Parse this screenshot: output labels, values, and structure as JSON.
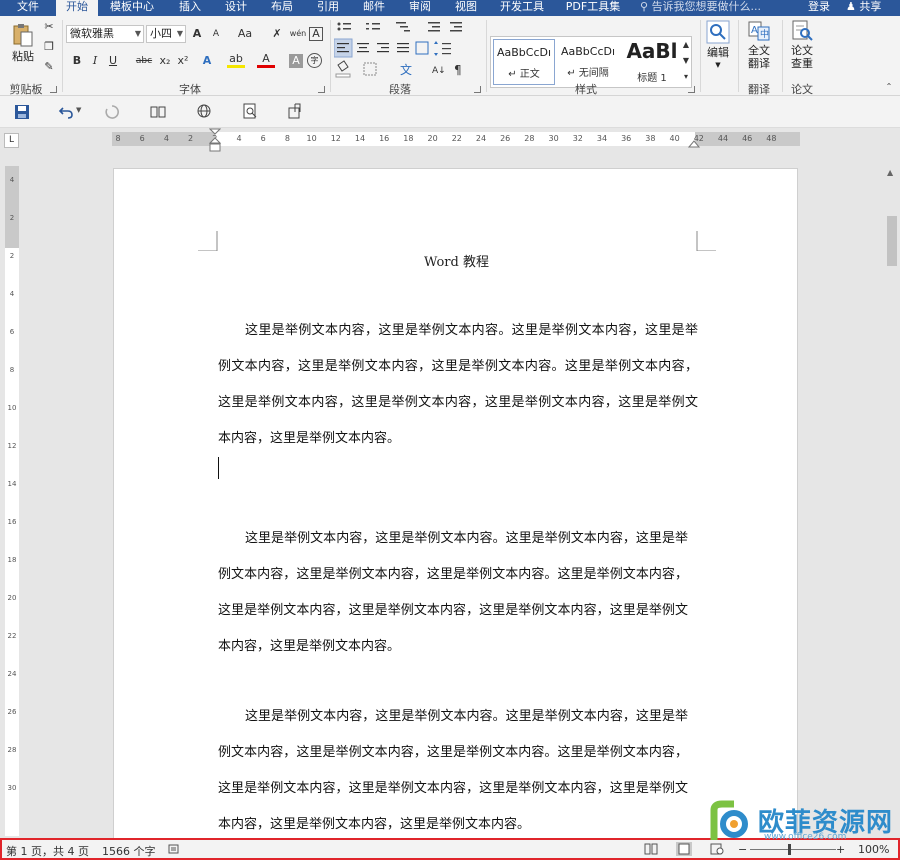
{
  "tabs": {
    "file": "文件",
    "home": "开始",
    "templates": "模板中心",
    "insert": "插入",
    "design": "设计",
    "layout": "布局",
    "references": "引用",
    "mailings": "邮件",
    "review": "审阅",
    "view": "视图",
    "developer": "开发工具",
    "pdf": "PDF工具集",
    "tell_me": "告诉我您想要做什么...",
    "login": "登录",
    "share": "共享"
  },
  "ribbon": {
    "clipboard": {
      "paste_label": "粘贴",
      "group_label": "剪贴板"
    },
    "font": {
      "font_name": "微软雅黑",
      "font_size": "小四",
      "group_label": "字体",
      "bold": "B",
      "italic": "I",
      "underline": "U",
      "strikethrough": "abc",
      "subscript": "x₂",
      "superscript": "x²",
      "grow": "A",
      "shrink": "A",
      "change_case": "Aa",
      "phonetic": "wén",
      "char_border": "A",
      "text_effects": "A",
      "highlight": "ab",
      "font_color": "A",
      "char_shading": "A",
      "enclose": "字"
    },
    "paragraph": {
      "group_label": "段落"
    },
    "styles": {
      "group_label": "样式",
      "items": [
        {
          "preview": "AaBbCcDı",
          "name": "↵ 正文"
        },
        {
          "preview": "AaBbCcDı",
          "name": "↵ 无间隔"
        },
        {
          "preview": "AaBl",
          "name": "标题 1"
        }
      ]
    },
    "editing": {
      "label": "编辑"
    },
    "translate": {
      "label_line1": "全文",
      "label_line2": "翻译",
      "group_label": "翻译"
    },
    "paper": {
      "label_line1": "论文",
      "label_line2": "查重",
      "group_label": "论文"
    }
  },
  "ruler": {
    "h_ticks": [
      "8",
      "6",
      "4",
      "2",
      "2",
      "4",
      "6",
      "8",
      "10",
      "12",
      "14",
      "16",
      "18",
      "20",
      "22",
      "24",
      "26",
      "28",
      "30",
      "32",
      "34",
      "36",
      "38",
      "40",
      "42",
      "44",
      "46",
      "48"
    ],
    "v_ticks": [
      "4",
      "2",
      "2",
      "4",
      "6",
      "8",
      "10",
      "12",
      "14",
      "16",
      "18",
      "20",
      "22",
      "24",
      "26",
      "28",
      "30"
    ]
  },
  "document": {
    "header": "Word 教程",
    "paragraphs": [
      "这里是举例文本内容，这里是举例文本内容。这里是举例文本内容，这里是举例文本内容，这里是举例文本内容，这里是举例文本内容。这里是举例文本内容，这里是举例文本内容，这里是举例文本内容，这里是举例文本内容，这里是举例文本内容，这里是举例文本内容。",
      "这里是举例文本内容，这里是举例文本内容。这里是举例文本内容，这里是举例文本内容，这里是举例文本内容，这里是举例文本内容。这里是举例文本内容，这里是举例文本内容，这里是举例文本内容，这里是举例文本内容，这里是举例文本内容，这里是举例文本内容。",
      "这里是举例文本内容，这里是举例文本内容。这里是举例文本内容，这里是举例文本内容，这里是举例文本内容，这里是举例文本内容。这里是举例文本内容，这里是举例文本内容，这里是举例文本内容，这里是举例文本内容，这里是举例文本内容，这里是举例文本内容，这里是举例文本内容。"
    ]
  },
  "status": {
    "page": "第 1 页，共 4 页",
    "words": "1566 个字",
    "zoom": "100%",
    "zoom_minus": "−",
    "zoom_plus": "+"
  },
  "watermark": {
    "text": "欧菲资源网",
    "url": "www.office26.com"
  },
  "colors": {
    "tab_blue": "#2b579a",
    "highlight_red": "#e0252b",
    "watermark_blue": "#2e8ccb"
  }
}
